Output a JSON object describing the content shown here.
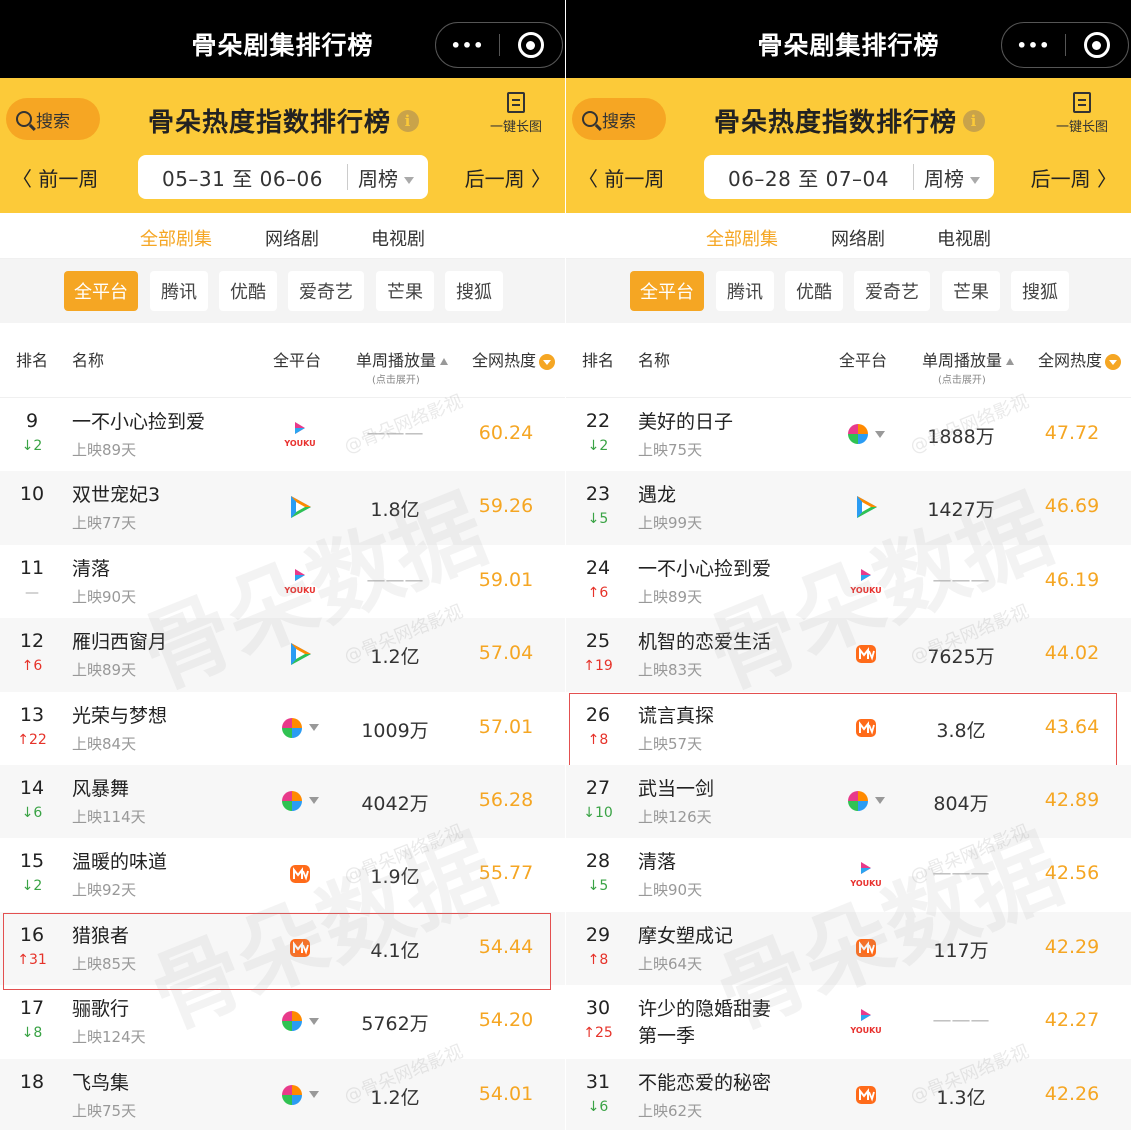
{
  "app": {
    "window_title": "骨朵剧集排行榜",
    "more_label": "•••",
    "search_label": "搜索",
    "page_title": "骨朵热度指数排行榜",
    "info_glyph": "i",
    "long_image_label": "一键长图",
    "prev_week": "〈 前一周",
    "next_week": "后一周 〉",
    "week_type": "周榜",
    "tabs": [
      "全部剧集",
      "网络剧",
      "电视剧"
    ],
    "platforms": [
      "全平台",
      "腾讯",
      "优酷",
      "爱奇艺",
      "芒果",
      "搜狐"
    ],
    "headers": {
      "rank": "排名",
      "name": "名称",
      "platform": "全平台",
      "weekly_plays": "单周播放量",
      "expand_hint": "(点击展开)",
      "heat": "全网热度"
    },
    "watermark_big": "骨朵数据",
    "watermark_small": "@骨朵网络影视"
  },
  "colors": {
    "accent": "#f5a623",
    "header_yellow": "#fcca39",
    "rank_up": "#e6332a",
    "rank_down": "#3aa345",
    "highlight_border": "#e35050"
  },
  "left": {
    "date_range": "05–31 至 06–06",
    "rows": [
      {
        "rank": "9",
        "change": "↓2",
        "dir": "down",
        "name": "一不小心捡到爱",
        "days": "上映89天",
        "platform": "youku",
        "plays": "———",
        "heat": "60.24"
      },
      {
        "rank": "10",
        "change": "",
        "dir": "none",
        "name": "双世宠妃3",
        "days": "上映77天",
        "platform": "tencent",
        "plays": "1.8亿",
        "heat": "59.26"
      },
      {
        "rank": "11",
        "change": "—",
        "dir": "flat",
        "name": "清落",
        "days": "上映90天",
        "platform": "youku",
        "plays": "———",
        "heat": "59.01"
      },
      {
        "rank": "12",
        "change": "↑6",
        "dir": "up",
        "name": "雁归西窗月",
        "days": "上映89天",
        "platform": "tencent",
        "plays": "1.2亿",
        "heat": "57.04"
      },
      {
        "rank": "13",
        "change": "↑22",
        "dir": "up",
        "name": "光荣与梦想",
        "days": "上映84天",
        "platform": "multi",
        "plays": "1009万",
        "heat": "57.01"
      },
      {
        "rank": "14",
        "change": "↓6",
        "dir": "down",
        "name": "风暴舞",
        "days": "上映114天",
        "platform": "multi",
        "plays": "4042万",
        "heat": "56.28"
      },
      {
        "rank": "15",
        "change": "↓2",
        "dir": "down",
        "name": "温暖的味道",
        "days": "上映92天",
        "platform": "mango",
        "plays": "1.9亿",
        "heat": "55.77"
      },
      {
        "rank": "16",
        "change": "↑31",
        "dir": "up",
        "name": "猎狼者",
        "days": "上映85天",
        "platform": "mango",
        "plays": "4.1亿",
        "heat": "54.44",
        "highlight": true
      },
      {
        "rank": "17",
        "change": "↓8",
        "dir": "down",
        "name": "骊歌行",
        "days": "上映124天",
        "platform": "multi",
        "plays": "5762万",
        "heat": "54.20"
      },
      {
        "rank": "18",
        "change": "",
        "dir": "none",
        "name": "飞鸟集",
        "days": "上映75天",
        "platform": "multi",
        "plays": "1.2亿",
        "heat": "54.01"
      }
    ]
  },
  "right": {
    "date_range": "06–28 至 07–04",
    "rows": [
      {
        "rank": "22",
        "change": "↓2",
        "dir": "down",
        "name": "美好的日子",
        "days": "上映75天",
        "platform": "multi",
        "plays": "1888万",
        "heat": "47.72"
      },
      {
        "rank": "23",
        "change": "↓5",
        "dir": "down",
        "name": "遇龙",
        "days": "上映99天",
        "platform": "tencent",
        "plays": "1427万",
        "heat": "46.69"
      },
      {
        "rank": "24",
        "change": "↑6",
        "dir": "up",
        "name": "一不小心捡到爱",
        "days": "上映89天",
        "platform": "youku",
        "plays": "———",
        "heat": "46.19"
      },
      {
        "rank": "25",
        "change": "↑19",
        "dir": "up",
        "name": "机智的恋爱生活",
        "days": "上映83天",
        "platform": "mango",
        "plays": "7625万",
        "heat": "44.02"
      },
      {
        "rank": "26",
        "change": "↑8",
        "dir": "up",
        "name": "谎言真探",
        "days": "上映57天",
        "platform": "mango",
        "plays": "3.8亿",
        "heat": "43.64",
        "highlight": true
      },
      {
        "rank": "27",
        "change": "↓10",
        "dir": "down",
        "name": "武当一剑",
        "days": "上映126天",
        "platform": "multi",
        "plays": "804万",
        "heat": "42.89"
      },
      {
        "rank": "28",
        "change": "↓5",
        "dir": "down",
        "name": "清落",
        "days": "上映90天",
        "platform": "youku",
        "plays": "———",
        "heat": "42.56"
      },
      {
        "rank": "29",
        "change": "↑8",
        "dir": "up",
        "name": "摩女塑成记",
        "days": "上映64天",
        "platform": "mango",
        "plays": "117万",
        "heat": "42.29"
      },
      {
        "rank": "30",
        "change": "↑25",
        "dir": "up",
        "name": "许少的隐婚甜妻",
        "name2": "第一季",
        "days": "",
        "platform": "youku",
        "plays": "———",
        "heat": "42.27"
      },
      {
        "rank": "31",
        "change": "↓6",
        "dir": "down",
        "name": "不能恋爱的秘密",
        "days": "上映62天",
        "platform": "mango",
        "plays": "1.3亿",
        "heat": "42.26"
      }
    ]
  }
}
